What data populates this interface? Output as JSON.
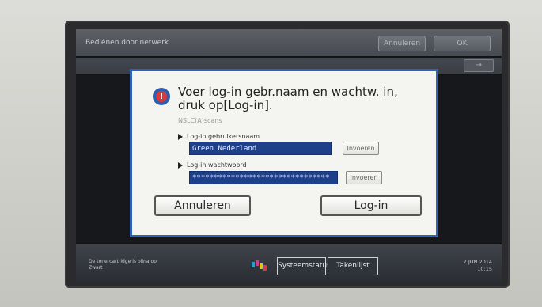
{
  "screen": {
    "title": "Bediénen door netwerk",
    "annuleren_top": "Annuleren",
    "ok": "OK",
    "nav_arrow": "→"
  },
  "dialog": {
    "message_line1": "Voer log-in gebr.naam en wachtw. in,",
    "message_line2": "druk op[Log-in].",
    "sub_text": "NSLC(A)scans",
    "username_label": "Log-in gebruikersnaam",
    "username_value": "Green Nederland",
    "password_label": "Log-in wachtwoord",
    "password_value": "********************************",
    "invoeren_label": "Invoeren",
    "cancel_label": "Annuleren",
    "login_label": "Log-in",
    "warn_icon": "!"
  },
  "status": {
    "toner_line1": "De tonercartridge is bijna op",
    "toner_line2": "Zwart",
    "tab_systemstatus": "Systeemstatus",
    "tab_takenlijst": "Takenlijst",
    "date": "7 JUN  2014",
    "time": "10:15"
  },
  "colors": {
    "accent": "#2e63b7",
    "input_fill": "#1e3f8a",
    "warning": "#d63b3b",
    "cyan": "#18a6d8",
    "magenta": "#d23c8c",
    "yellow": "#e2c21d",
    "black": "#1e1e1e"
  }
}
